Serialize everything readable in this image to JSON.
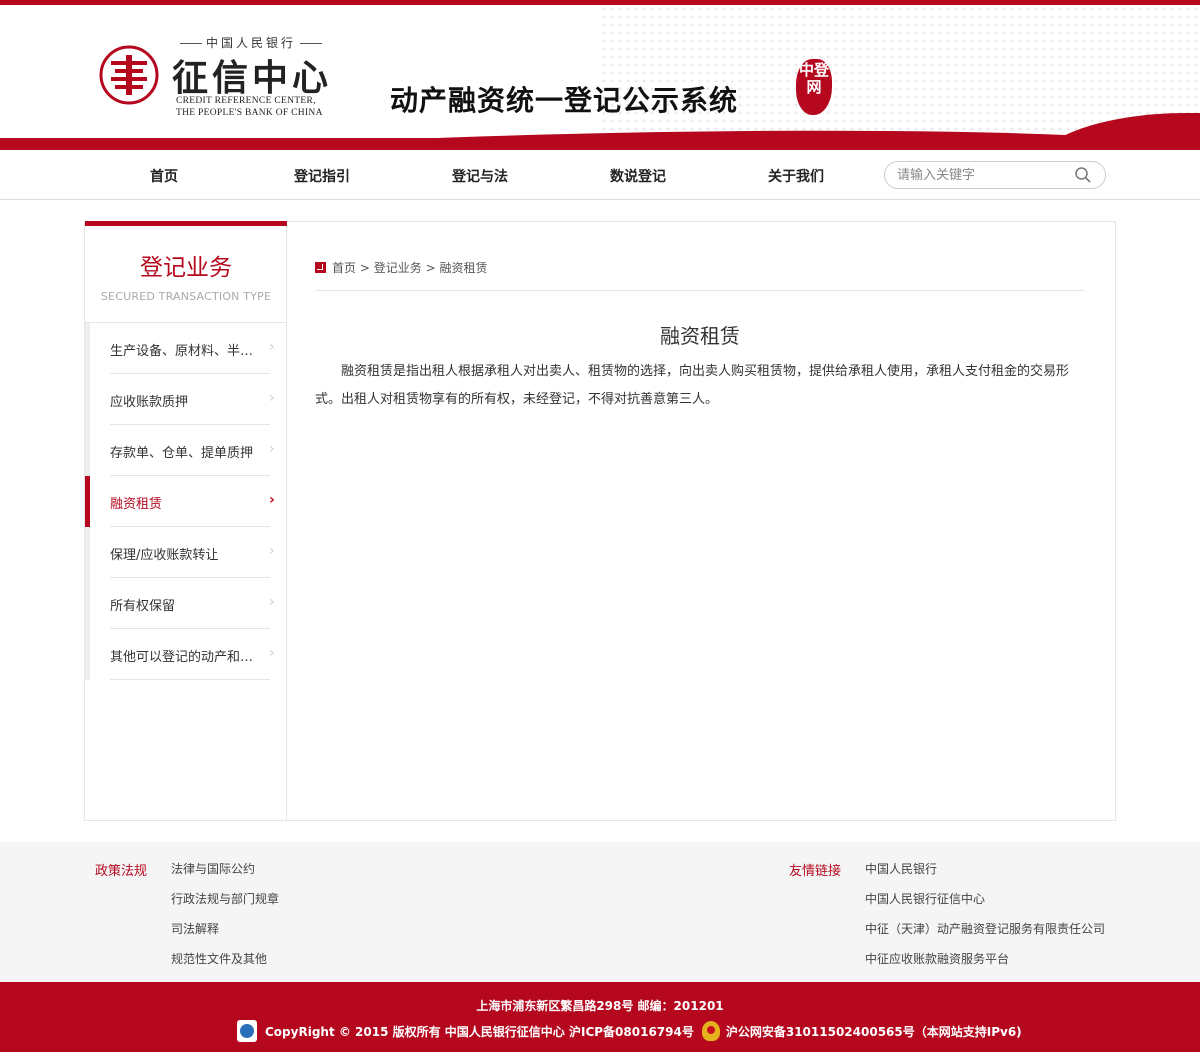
{
  "header": {
    "logo_top": "中国人民银行",
    "logo_cn": "征信中心",
    "logo_en_line1": "CREDIT REFERENCE CENTER,",
    "logo_en_line2": "THE PEOPLE'S BANK OF CHINA",
    "system_title": "动产融资统一登记公示系统",
    "seal_text": "中登网"
  },
  "nav": {
    "items": [
      {
        "label": "首页"
      },
      {
        "label": "登记指引"
      },
      {
        "label": "登记与法"
      },
      {
        "label": "数说登记"
      },
      {
        "label": "关于我们"
      }
    ],
    "search_placeholder": "请输入关键字"
  },
  "sidebar": {
    "title": "登记业务",
    "subtitle": "SECURED TRANSACTION TYPE",
    "items": [
      {
        "label": "生产设备、原材料、半…"
      },
      {
        "label": "应收账款质押"
      },
      {
        "label": "存款单、仓单、提单质押"
      },
      {
        "label": "融资租赁",
        "active": true
      },
      {
        "label": "保理/应收账款转让"
      },
      {
        "label": "所有权保留"
      },
      {
        "label": "其他可以登记的动产和…"
      }
    ]
  },
  "breadcrumb": {
    "items": [
      "首页",
      "登记业务",
      "融资租赁"
    ],
    "separator": ">"
  },
  "article": {
    "title": "融资租赁",
    "body": "融资租赁是指出租人根据承租人对出卖人、租赁物的选择，向出卖人购买租赁物，提供给承租人使用，承租人支付租金的交易形式。出租人对租赁物享有的所有权，未经登记，不得对抗善意第三人。"
  },
  "footer_links": {
    "policy_heading": "政策法规",
    "policy_links": [
      "法律与国际公约",
      "行政法规与部门规章",
      "司法解释",
      "规范性文件及其他"
    ],
    "friend_heading": "友情链接",
    "friend_links": [
      "中国人民银行",
      "中国人民银行征信中心",
      "中征（天津）动产融资登记服务有限责任公司",
      "中征应收账款融资服务平台"
    ]
  },
  "footer": {
    "address": "上海市浦东新区繁昌路298号 邮编：201201",
    "copyright": "CopyRight © 2015 版权所有 中国人民银行征信中心 沪ICP备08016794号",
    "police": "沪公网安备31011502400565号（本网站支持IPv6)"
  },
  "colors": {
    "brand_red": "#b5081f",
    "footer_bg": "#f5f5f5"
  }
}
